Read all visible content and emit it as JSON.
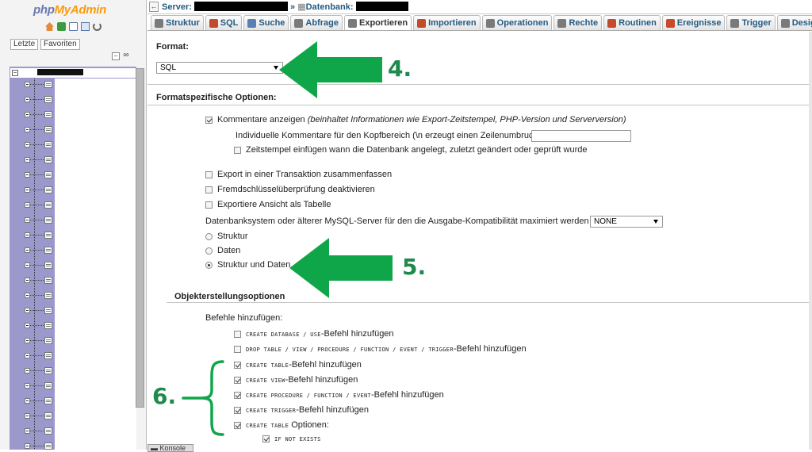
{
  "nav": {
    "logo_part1": "php",
    "logo_part2": "MyAdmin",
    "recent_tab": "Letzte",
    "favorites_tab": "Favoriten"
  },
  "topbar": {
    "server_label": "Server:",
    "separator": "»",
    "database_label": "Datenbank:"
  },
  "tabs": [
    {
      "label": "Struktur",
      "icon": "table-structure-icon",
      "color": "#7a7a7a"
    },
    {
      "label": "SQL",
      "icon": "sql-icon",
      "color": "#c34a2c"
    },
    {
      "label": "Suche",
      "icon": "search-icon",
      "color": "#5a7fb5"
    },
    {
      "label": "Abfrage",
      "icon": "query-icon",
      "color": "#7a7a7a"
    },
    {
      "label": "Exportieren",
      "icon": "export-icon",
      "color": "#7a7a7a",
      "active": true
    },
    {
      "label": "Importieren",
      "icon": "import-icon",
      "color": "#c44a2c"
    },
    {
      "label": "Operationen",
      "icon": "wrench-icon",
      "color": "#7a7a7a"
    },
    {
      "label": "Rechte",
      "icon": "privileges-icon",
      "color": "#7a7a7a"
    },
    {
      "label": "Routinen",
      "icon": "routines-icon",
      "color": "#c44a2c"
    },
    {
      "label": "Ereignisse",
      "icon": "clock-icon",
      "color": "#c84a2c"
    },
    {
      "label": "Trigger",
      "icon": "trigger-icon",
      "color": "#7a7a7a"
    },
    {
      "label": "Designer",
      "icon": "designer-icon",
      "color": "#7a7a7a"
    }
  ],
  "format": {
    "heading": "Format:",
    "value": "SQL"
  },
  "format_options": {
    "heading": "Formatspezifische Optionen:",
    "comments_label": "Kommentare anzeigen",
    "comments_hint": "(beinhaltet Informationen wie Export-Zeitstempel, PHP-Version und Serverversion)",
    "header_comment_label": "Individuelle Kommentare für den Kopfbereich (\\n erzeugt einen Zeilenumbruch):",
    "timestamp_label": "Zeitstempel einfügen wann die Datenbank angelegt, zuletzt geändert oder geprüft wurde",
    "transaction_label": "Export in einer Transaktion zusammenfassen",
    "fk_label": "Fremdschlüsselüberprüfung deaktivieren",
    "view_as_table_label": "Exportiere Ansicht als Tabelle",
    "compat_label": "Datenbanksystem oder älterer MySQL-Server für den die Ausgabe-Kompatibilität maximiert werden soll:",
    "compat_value": "NONE",
    "radio_structure": "Struktur",
    "radio_data": "Daten",
    "radio_both": "Struktur und Daten"
  },
  "object_options": {
    "heading": "Objekterstellungsoptionen",
    "add_commands": "Befehle hinzufügen:",
    "create_db_code": "CREATE DATABASE / USE",
    "create_db_suffix": "-Befehl hinzufügen",
    "drop_code": "DROP TABLE / VIEW / PROCEDURE / FUNCTION / EVENT / TRIGGER",
    "drop_suffix": "-Befehl hinzufügen",
    "create_table_code": "CREATE TABLE",
    "create_table_suffix": "-Befehl hinzufügen",
    "create_view_code": "CREATE VIEW",
    "create_view_suffix": "-Befehl hinzufügen",
    "create_proc_code": "CREATE PROCEDURE / FUNCTION / EVENT",
    "create_proc_suffix": "-Befehl hinzufügen",
    "create_trigger_code": "CREATE TRIGGER",
    "create_trigger_suffix": "-Befehl hinzufügen",
    "create_table_opts_code": "CREATE TABLE",
    "create_table_opts_suffix": "Optionen:",
    "if_not_exists_code": "IF NOT EXISTS"
  },
  "console_label": "Konsole",
  "annotations": {
    "step4": "4.",
    "step5": "5.",
    "step6": "6.",
    "arrow_color": "#0fa64a"
  }
}
